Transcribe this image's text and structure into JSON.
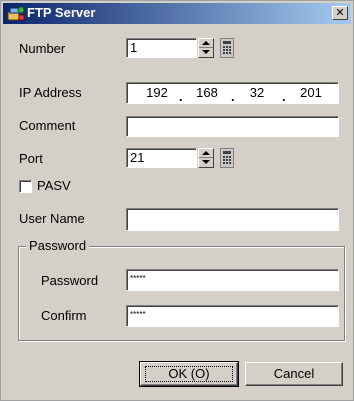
{
  "window": {
    "title": "FTP Server",
    "close_glyph": "✕"
  },
  "icons": {
    "title": "ftp-server-icon",
    "close": "close-icon"
  },
  "number": {
    "label": "Number",
    "value": "1"
  },
  "ip": {
    "label": "IP Address",
    "octets": [
      "192",
      "168",
      "32",
      "201"
    ]
  },
  "comment": {
    "label": "Comment",
    "value": ""
  },
  "port": {
    "label": "Port",
    "value": "21"
  },
  "pasv": {
    "label": "PASV",
    "checked": false
  },
  "user": {
    "label": "User Name",
    "value": ""
  },
  "password_group": {
    "title": "Password",
    "password_label": "Password",
    "password_value": "*****",
    "confirm_label": "Confirm",
    "confirm_value": "*****"
  },
  "buttons": {
    "ok": "OK (O)",
    "cancel": "Cancel"
  },
  "colors": {
    "face": "#d4d0c8",
    "title_start": "#0a246a",
    "title_end": "#a6caf0"
  }
}
